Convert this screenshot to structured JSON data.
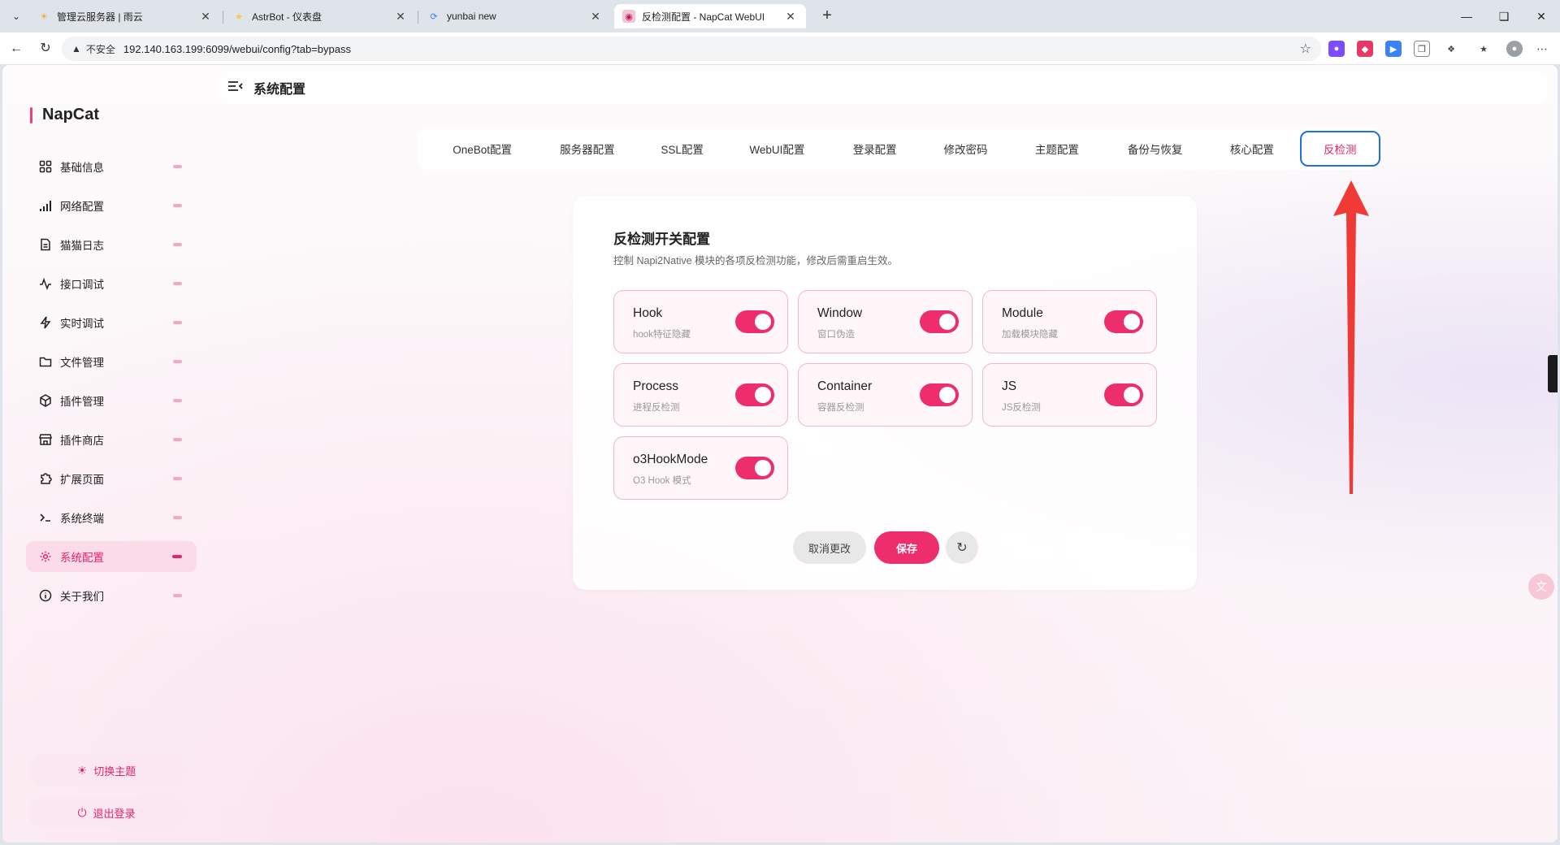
{
  "browser": {
    "tabs": [
      {
        "title": "管理云服务器 | 雨云",
        "icon": "rainyun-icon"
      },
      {
        "title": "AstrBot - 仪表盘",
        "icon": "astrbot-icon"
      },
      {
        "title": "yunbai new",
        "icon": "yunbai-icon"
      },
      {
        "title": "反检测配置 - NapCat WebUI",
        "icon": "napcat-icon"
      }
    ],
    "security_label": "不安全",
    "url": "192.140.163.199:6099/webui/config?tab=bypass"
  },
  "brand": "NapCat",
  "sidebar": {
    "items": [
      {
        "label": "基础信息",
        "icon": "dashboard-icon"
      },
      {
        "label": "网络配置",
        "icon": "signal-icon"
      },
      {
        "label": "猫猫日志",
        "icon": "log-icon"
      },
      {
        "label": "接口调试",
        "icon": "pulse-icon"
      },
      {
        "label": "实时调试",
        "icon": "lightning-icon"
      },
      {
        "label": "文件管理",
        "icon": "folder-icon"
      },
      {
        "label": "插件管理",
        "icon": "package-icon"
      },
      {
        "label": "插件商店",
        "icon": "store-icon"
      },
      {
        "label": "扩展页面",
        "icon": "puzzle-icon"
      },
      {
        "label": "系统终端",
        "icon": "terminal-icon"
      },
      {
        "label": "系统配置",
        "icon": "gear-icon"
      },
      {
        "label": "关于我们",
        "icon": "info-icon"
      }
    ],
    "active_index": 10,
    "theme_button": "切换主题",
    "logout_button": "退出登录"
  },
  "header": {
    "title": "系统配置"
  },
  "config_tabs": {
    "items": [
      "OneBot配置",
      "服务器配置",
      "SSL配置",
      "WebUI配置",
      "登录配置",
      "修改密码",
      "主题配置",
      "备份与恢复",
      "核心配置",
      "反检测"
    ],
    "active_index": 9
  },
  "card": {
    "title": "反检测开关配置",
    "description": "控制 Napi2Native 模块的各项反检测功能，修改后需重启生效。",
    "options": [
      {
        "name": "Hook",
        "desc": "hook特征隐藏",
        "enabled": true
      },
      {
        "name": "Window",
        "desc": "窗口伪造",
        "enabled": true
      },
      {
        "name": "Module",
        "desc": "加载模块隐藏",
        "enabled": true
      },
      {
        "name": "Process",
        "desc": "进程反检测",
        "enabled": true
      },
      {
        "name": "Container",
        "desc": "容器反检测",
        "enabled": true
      },
      {
        "name": "JS",
        "desc": "JS反检测",
        "enabled": true
      },
      {
        "name": "o3HookMode",
        "desc": "O3 Hook 模式",
        "enabled": true
      }
    ],
    "cancel_button": "取消更改",
    "save_button": "保存"
  },
  "colors": {
    "accent": "#ee2d6d",
    "active_tab_border": "#1f6fe5",
    "annotation_arrow": "#f03a35"
  }
}
